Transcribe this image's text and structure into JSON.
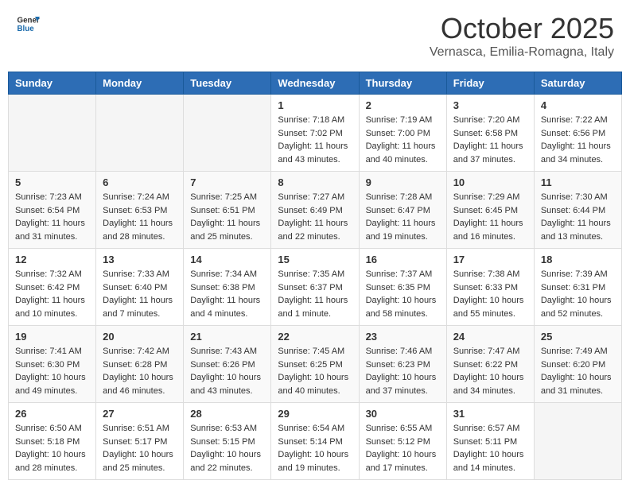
{
  "header": {
    "logo_general": "General",
    "logo_blue": "Blue",
    "main_title": "October 2025",
    "subtitle": "Vernasca, Emilia-Romagna, Italy"
  },
  "weekdays": [
    "Sunday",
    "Monday",
    "Tuesday",
    "Wednesday",
    "Thursday",
    "Friday",
    "Saturday"
  ],
  "weeks": [
    [
      {
        "day": "",
        "info": ""
      },
      {
        "day": "",
        "info": ""
      },
      {
        "day": "",
        "info": ""
      },
      {
        "day": "1",
        "info": "Sunrise: 7:18 AM\nSunset: 7:02 PM\nDaylight: 11 hours and 43 minutes."
      },
      {
        "day": "2",
        "info": "Sunrise: 7:19 AM\nSunset: 7:00 PM\nDaylight: 11 hours and 40 minutes."
      },
      {
        "day": "3",
        "info": "Sunrise: 7:20 AM\nSunset: 6:58 PM\nDaylight: 11 hours and 37 minutes."
      },
      {
        "day": "4",
        "info": "Sunrise: 7:22 AM\nSunset: 6:56 PM\nDaylight: 11 hours and 34 minutes."
      }
    ],
    [
      {
        "day": "5",
        "info": "Sunrise: 7:23 AM\nSunset: 6:54 PM\nDaylight: 11 hours and 31 minutes."
      },
      {
        "day": "6",
        "info": "Sunrise: 7:24 AM\nSunset: 6:53 PM\nDaylight: 11 hours and 28 minutes."
      },
      {
        "day": "7",
        "info": "Sunrise: 7:25 AM\nSunset: 6:51 PM\nDaylight: 11 hours and 25 minutes."
      },
      {
        "day": "8",
        "info": "Sunrise: 7:27 AM\nSunset: 6:49 PM\nDaylight: 11 hours and 22 minutes."
      },
      {
        "day": "9",
        "info": "Sunrise: 7:28 AM\nSunset: 6:47 PM\nDaylight: 11 hours and 19 minutes."
      },
      {
        "day": "10",
        "info": "Sunrise: 7:29 AM\nSunset: 6:45 PM\nDaylight: 11 hours and 16 minutes."
      },
      {
        "day": "11",
        "info": "Sunrise: 7:30 AM\nSunset: 6:44 PM\nDaylight: 11 hours and 13 minutes."
      }
    ],
    [
      {
        "day": "12",
        "info": "Sunrise: 7:32 AM\nSunset: 6:42 PM\nDaylight: 11 hours and 10 minutes."
      },
      {
        "day": "13",
        "info": "Sunrise: 7:33 AM\nSunset: 6:40 PM\nDaylight: 11 hours and 7 minutes."
      },
      {
        "day": "14",
        "info": "Sunrise: 7:34 AM\nSunset: 6:38 PM\nDaylight: 11 hours and 4 minutes."
      },
      {
        "day": "15",
        "info": "Sunrise: 7:35 AM\nSunset: 6:37 PM\nDaylight: 11 hours and 1 minute."
      },
      {
        "day": "16",
        "info": "Sunrise: 7:37 AM\nSunset: 6:35 PM\nDaylight: 10 hours and 58 minutes."
      },
      {
        "day": "17",
        "info": "Sunrise: 7:38 AM\nSunset: 6:33 PM\nDaylight: 10 hours and 55 minutes."
      },
      {
        "day": "18",
        "info": "Sunrise: 7:39 AM\nSunset: 6:31 PM\nDaylight: 10 hours and 52 minutes."
      }
    ],
    [
      {
        "day": "19",
        "info": "Sunrise: 7:41 AM\nSunset: 6:30 PM\nDaylight: 10 hours and 49 minutes."
      },
      {
        "day": "20",
        "info": "Sunrise: 7:42 AM\nSunset: 6:28 PM\nDaylight: 10 hours and 46 minutes."
      },
      {
        "day": "21",
        "info": "Sunrise: 7:43 AM\nSunset: 6:26 PM\nDaylight: 10 hours and 43 minutes."
      },
      {
        "day": "22",
        "info": "Sunrise: 7:45 AM\nSunset: 6:25 PM\nDaylight: 10 hours and 40 minutes."
      },
      {
        "day": "23",
        "info": "Sunrise: 7:46 AM\nSunset: 6:23 PM\nDaylight: 10 hours and 37 minutes."
      },
      {
        "day": "24",
        "info": "Sunrise: 7:47 AM\nSunset: 6:22 PM\nDaylight: 10 hours and 34 minutes."
      },
      {
        "day": "25",
        "info": "Sunrise: 7:49 AM\nSunset: 6:20 PM\nDaylight: 10 hours and 31 minutes."
      }
    ],
    [
      {
        "day": "26",
        "info": "Sunrise: 6:50 AM\nSunset: 5:18 PM\nDaylight: 10 hours and 28 minutes."
      },
      {
        "day": "27",
        "info": "Sunrise: 6:51 AM\nSunset: 5:17 PM\nDaylight: 10 hours and 25 minutes."
      },
      {
        "day": "28",
        "info": "Sunrise: 6:53 AM\nSunset: 5:15 PM\nDaylight: 10 hours and 22 minutes."
      },
      {
        "day": "29",
        "info": "Sunrise: 6:54 AM\nSunset: 5:14 PM\nDaylight: 10 hours and 19 minutes."
      },
      {
        "day": "30",
        "info": "Sunrise: 6:55 AM\nSunset: 5:12 PM\nDaylight: 10 hours and 17 minutes."
      },
      {
        "day": "31",
        "info": "Sunrise: 6:57 AM\nSunset: 5:11 PM\nDaylight: 10 hours and 14 minutes."
      },
      {
        "day": "",
        "info": ""
      }
    ]
  ]
}
